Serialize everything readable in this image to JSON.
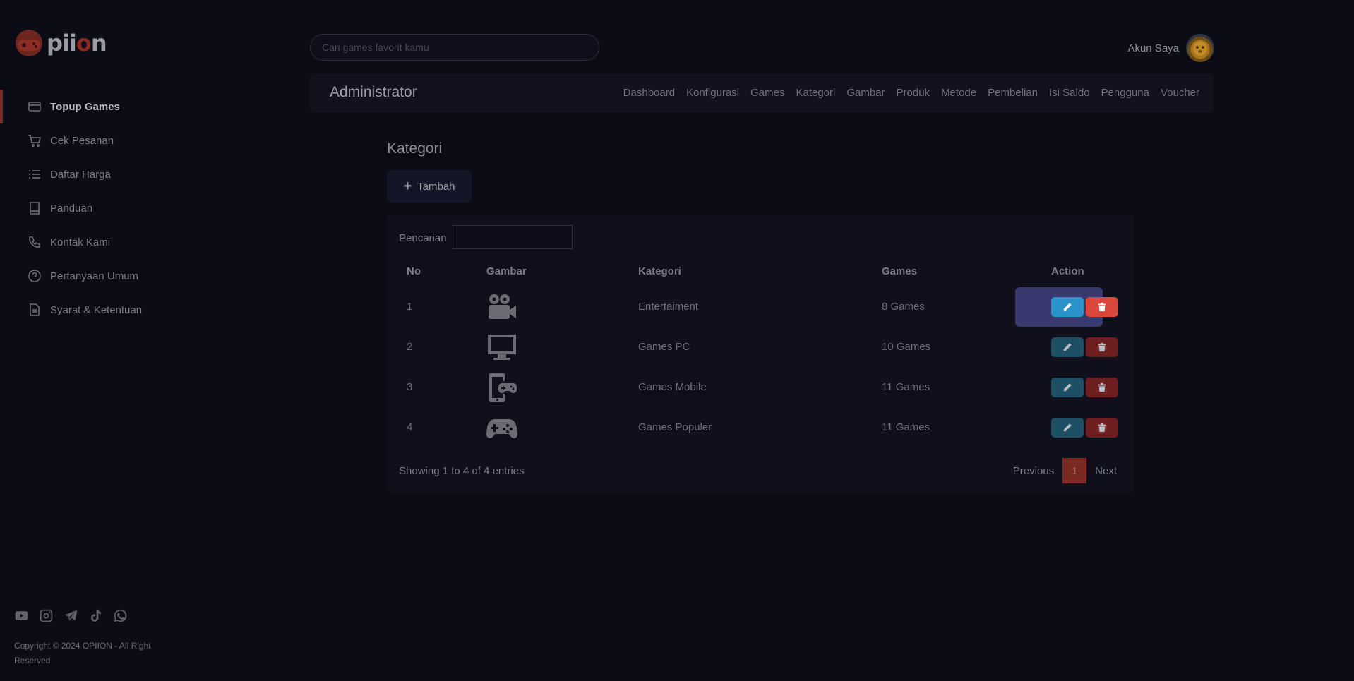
{
  "brand": {
    "name_prefix": "pii",
    "name_o": "o",
    "name_suffix": "n"
  },
  "search": {
    "placeholder": "Cari games favorit kamu"
  },
  "account": {
    "label": "Akun Saya"
  },
  "sidebar": {
    "items": [
      {
        "label": "Topup Games",
        "icon": "credit-card-icon",
        "active": true
      },
      {
        "label": "Cek Pesanan",
        "icon": "cart-icon"
      },
      {
        "label": "Daftar Harga",
        "icon": "list-icon"
      },
      {
        "label": "Panduan",
        "icon": "book-icon"
      },
      {
        "label": "Kontak Kami",
        "icon": "phone-icon"
      },
      {
        "label": "Pertanyaan Umum",
        "icon": "question-circle-icon"
      },
      {
        "label": "Syarat & Ketentuan",
        "icon": "document-icon"
      }
    ],
    "socials": [
      "youtube-icon",
      "instagram-icon",
      "telegram-icon",
      "tiktok-icon",
      "whatsapp-icon"
    ],
    "copyright": "Copyright © 2024 OPIION - All Right Reserved"
  },
  "admin": {
    "title": "Administrator",
    "menu": [
      "Dashboard",
      "Konfigurasi",
      "Games",
      "Kategori",
      "Gambar",
      "Produk",
      "Metode",
      "Pembelian",
      "Isi Saldo",
      "Pengguna",
      "Voucher"
    ]
  },
  "page": {
    "title": "Kategori",
    "add_label": "Tambah",
    "search_label": "Pencarian"
  },
  "table": {
    "headers": {
      "no": "No",
      "gambar": "Gambar",
      "kategori": "Kategori",
      "games": "Games",
      "action": "Action"
    },
    "rows": [
      {
        "no": "1",
        "icon": "video-camera-icon",
        "kategori": "Entertaiment",
        "games": "8 Games"
      },
      {
        "no": "2",
        "icon": "desktop-icon",
        "kategori": "Games PC",
        "games": "10 Games"
      },
      {
        "no": "3",
        "icon": "mobile-gamepad-icon",
        "kategori": "Games Mobile",
        "games": "11 Games"
      },
      {
        "no": "4",
        "icon": "gamepad-icon",
        "kategori": "Games Populer",
        "games": "11 Games"
      }
    ],
    "info": "Showing 1 to 4 of 4 entries",
    "pager": {
      "previous": "Previous",
      "current": "1",
      "next": "Next"
    }
  },
  "colors": {
    "accent": "#7a2a22",
    "edit": "#2a93c9",
    "delete": "#d9473d",
    "background": "#0b0c16"
  }
}
